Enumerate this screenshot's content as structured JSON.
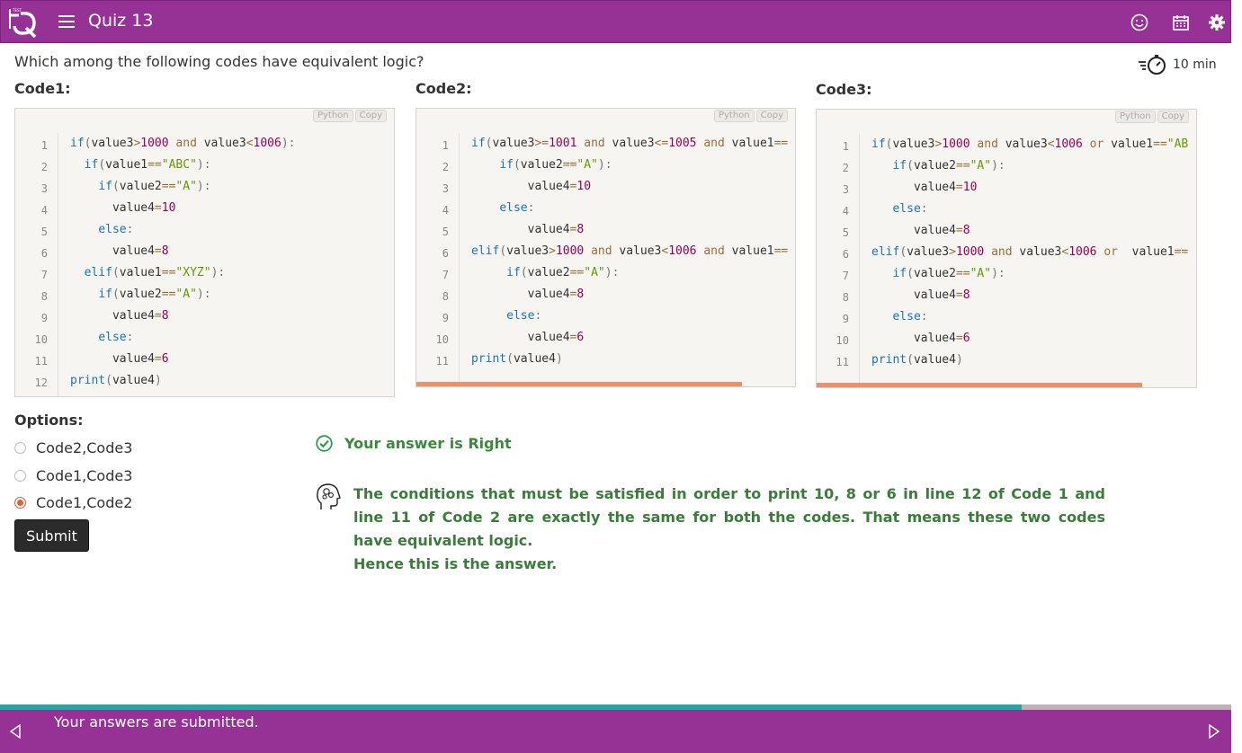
{
  "header": {
    "title": "Quiz 13",
    "icons": [
      "logo-icon",
      "menu-icon",
      "smiley-icon",
      "calendar-icon",
      "gear-icon"
    ]
  },
  "question": {
    "text": "Which among the following codes have equivalent logic?",
    "timer": "10 min"
  },
  "codes": [
    {
      "title": "Code1:",
      "language": "Python",
      "copy": "Copy",
      "lines": [
        "if(value3>1000 and value3<1006):",
        "  if(value1==\"ABC\"):",
        "    if(value2==\"A\"):",
        "      value4=10",
        "    else:",
        "      value4=8",
        "  elif(value1==\"XYZ\"):",
        "    if(value2==\"A\"):",
        "      value4=8",
        "    else:",
        "      value4=6",
        "print(value4)"
      ]
    },
    {
      "title": "Code2:",
      "language": "Python",
      "copy": "Copy",
      "lines": [
        "if(value3>=1001 and value3<=1005 and value1==",
        "    if(value2==\"A\"):",
        "        value4=10",
        "    else:",
        "        value4=8",
        "elif(value3>1000 and value3<1006 and value1==",
        "     if(value2==\"A\"):",
        "        value4=8",
        "     else:",
        "        value4=6",
        "print(value4)"
      ]
    },
    {
      "title": "Code3:",
      "language": "Python",
      "copy": "Copy",
      "lines": [
        "if(value3>1000 and value3<1006 or value1==\"AB",
        "   if(value2==\"A\"):",
        "      value4=10",
        "   else:",
        "      value4=8",
        "elif(value3>1000 and value3<1006 or  value1==",
        "   if(value2==\"A\"):",
        "      value4=8",
        "   else:",
        "      value4=6",
        "print(value4)"
      ]
    }
  ],
  "options": {
    "title": "Options:",
    "items": [
      {
        "label": "Code2,Code3",
        "selected": false
      },
      {
        "label": "Code1,Code3",
        "selected": false
      },
      {
        "label": "Code1,Code2",
        "selected": true
      }
    ],
    "submit_label": "Submit"
  },
  "feedback": {
    "result": "Your answer is Right",
    "explanation": "The conditions that must be satisfied in order to print 10, 8 or 6 in line 12 of Code 1 and line 11 of Code 2 are exactly the same for both the codes. That means these two codes have equivalent logic.",
    "conclusion": "Hence this is the answer."
  },
  "footer": {
    "message": "Your answers are submitted.",
    "progress_fraction": 0.83
  },
  "colors": {
    "brand": "#963296",
    "progress": "#26a5a5",
    "success": "#3a8a3a",
    "accent": "#e0603a"
  }
}
